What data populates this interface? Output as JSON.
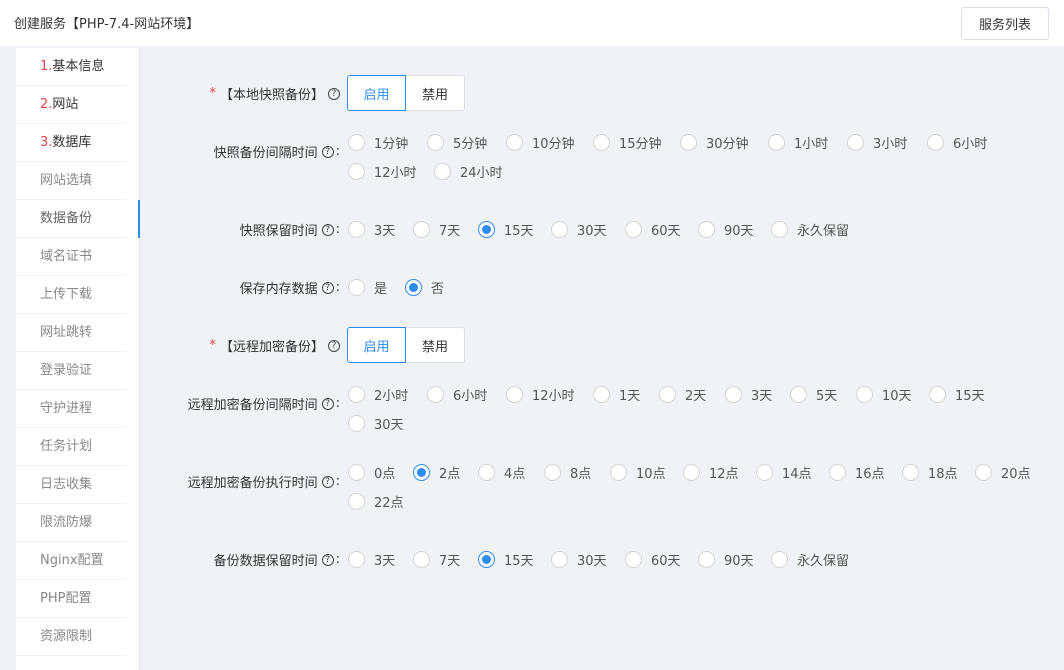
{
  "page": {
    "title": "创建服务【PHP-7.4-网站环境】",
    "service_list_button": "服务列表"
  },
  "sidebar": [
    {
      "num": "1.",
      "label": "基本信息"
    },
    {
      "num": "2.",
      "label": "网站"
    },
    {
      "num": "3.",
      "label": "数据库"
    },
    {
      "num": "",
      "label": "网站选填"
    },
    {
      "num": "",
      "label": "数据备份"
    },
    {
      "num": "",
      "label": "域名证书"
    },
    {
      "num": "",
      "label": "上传下载"
    },
    {
      "num": "",
      "label": "网址跳转"
    },
    {
      "num": "",
      "label": "登录验证"
    },
    {
      "num": "",
      "label": "守护进程"
    },
    {
      "num": "",
      "label": "任务计划"
    },
    {
      "num": "",
      "label": "日志收集"
    },
    {
      "num": "",
      "label": "限流防爆"
    },
    {
      "num": "",
      "label": "Nginx配置"
    },
    {
      "num": "",
      "label": "PHP配置"
    },
    {
      "num": "",
      "label": "资源限制"
    }
  ],
  "form": {
    "local_snapshot": {
      "label": "【本地快照备份】",
      "enable": "启用",
      "disable": "禁用"
    },
    "snapshot_interval": {
      "label": "快照备份间隔时间",
      "options": [
        "1分钟",
        "5分钟",
        "10分钟",
        "15分钟",
        "30分钟",
        "1小时",
        "3小时",
        "6小时",
        "12小时",
        "24小时"
      ],
      "selected": ""
    },
    "snapshot_retention": {
      "label": "快照保留时间",
      "options": [
        "3天",
        "7天",
        "15天",
        "30天",
        "60天",
        "90天",
        "永久保留"
      ],
      "selected": "15天"
    },
    "save_memory": {
      "label": "保存内存数据",
      "options": [
        "是",
        "否"
      ],
      "selected": "否"
    },
    "remote_backup": {
      "label": "【远程加密备份】",
      "enable": "启用",
      "disable": "禁用"
    },
    "remote_interval": {
      "label": "远程加密备份间隔时间",
      "options": [
        "2小时",
        "6小时",
        "12小时",
        "1天",
        "2天",
        "3天",
        "5天",
        "10天",
        "15天",
        "30天"
      ],
      "selected": ""
    },
    "remote_exec_time": {
      "label": "远程加密备份执行时间",
      "options": [
        "0点",
        "2点",
        "4点",
        "8点",
        "10点",
        "12点",
        "14点",
        "16点",
        "18点",
        "20点",
        "22点"
      ],
      "selected": "2点"
    },
    "backup_retention": {
      "label": "备份数据保留时间",
      "options": [
        "3天",
        "7天",
        "15天",
        "30天",
        "60天",
        "90天",
        "永久保留"
      ],
      "selected": "15天"
    }
  }
}
